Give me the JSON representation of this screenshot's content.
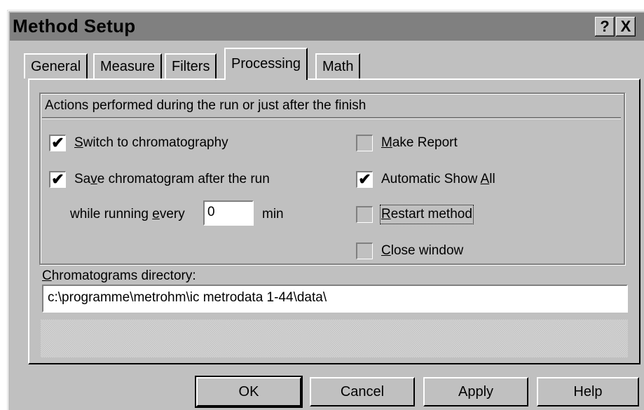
{
  "window": {
    "title": "Method Setup",
    "help_glyph": "?",
    "close_glyph": "X"
  },
  "tabs": [
    {
      "label": "General",
      "active": false
    },
    {
      "label": "Measure",
      "active": false
    },
    {
      "label": "Filters",
      "active": false
    },
    {
      "label": "Processing",
      "active": true
    },
    {
      "label": "Math",
      "active": false
    }
  ],
  "processing": {
    "group_title": "Actions performed during the run or just after the finish",
    "switch_chromatography": {
      "pre": "",
      "key": "S",
      "post": "witch to chromatography",
      "checked": true
    },
    "save_chromatogram": {
      "pre": "Sa",
      "key": "v",
      "post": "e chromatogram after the run",
      "checked": true
    },
    "while_running": {
      "pre": "while running ",
      "key": "e",
      "post": "very",
      "value": "0",
      "unit": "min"
    },
    "make_report": {
      "pre": "",
      "key": "M",
      "post": "ake Report",
      "checked": false
    },
    "automatic_show_all": {
      "pre": "Automatic Show ",
      "key": "A",
      "post": "ll",
      "checked": true
    },
    "restart_method": {
      "pre": "",
      "key": "R",
      "post": "estart method",
      "checked": false
    },
    "close_window": {
      "pre": "",
      "key": "C",
      "post": "lose window",
      "checked": false
    },
    "directory_label": {
      "pre": "",
      "key": "C",
      "post": "hromatograms directory:"
    },
    "directory_value": "c:\\programme\\metrohm\\ic metrodata 1-44\\data\\"
  },
  "buttons": {
    "ok": "OK",
    "cancel": "Cancel",
    "apply": "Apply",
    "help": "Help"
  },
  "check_glyph": "✔"
}
